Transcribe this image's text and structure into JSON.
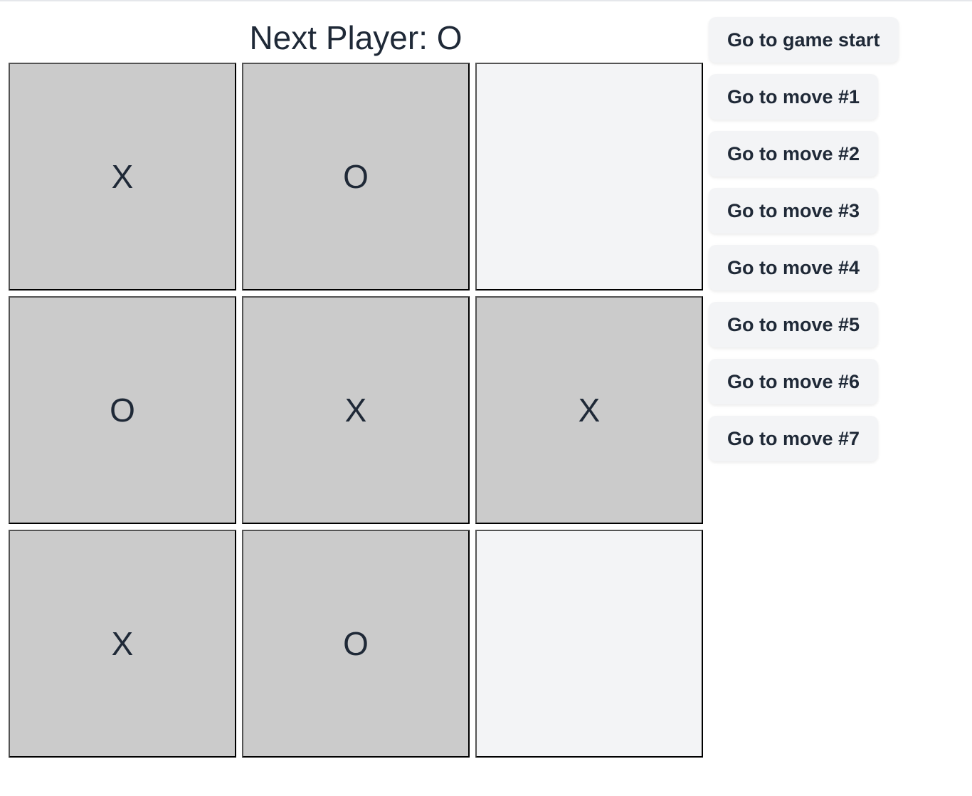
{
  "status": {
    "label": "Next Player: O"
  },
  "board": {
    "squares": [
      "X",
      "O",
      "",
      "O",
      "X",
      "X",
      "X",
      "O",
      ""
    ]
  },
  "history": {
    "moves": [
      "Go to game start",
      "Go to move #1",
      "Go to move #2",
      "Go to move #3",
      "Go to move #4",
      "Go to move #5",
      "Go to move #6",
      "Go to move #7"
    ]
  },
  "colors": {
    "filled_square": "#cbcbcb",
    "empty_square": "#f3f4f6",
    "text": "#1f2937",
    "button_bg": "#f3f4f6"
  }
}
